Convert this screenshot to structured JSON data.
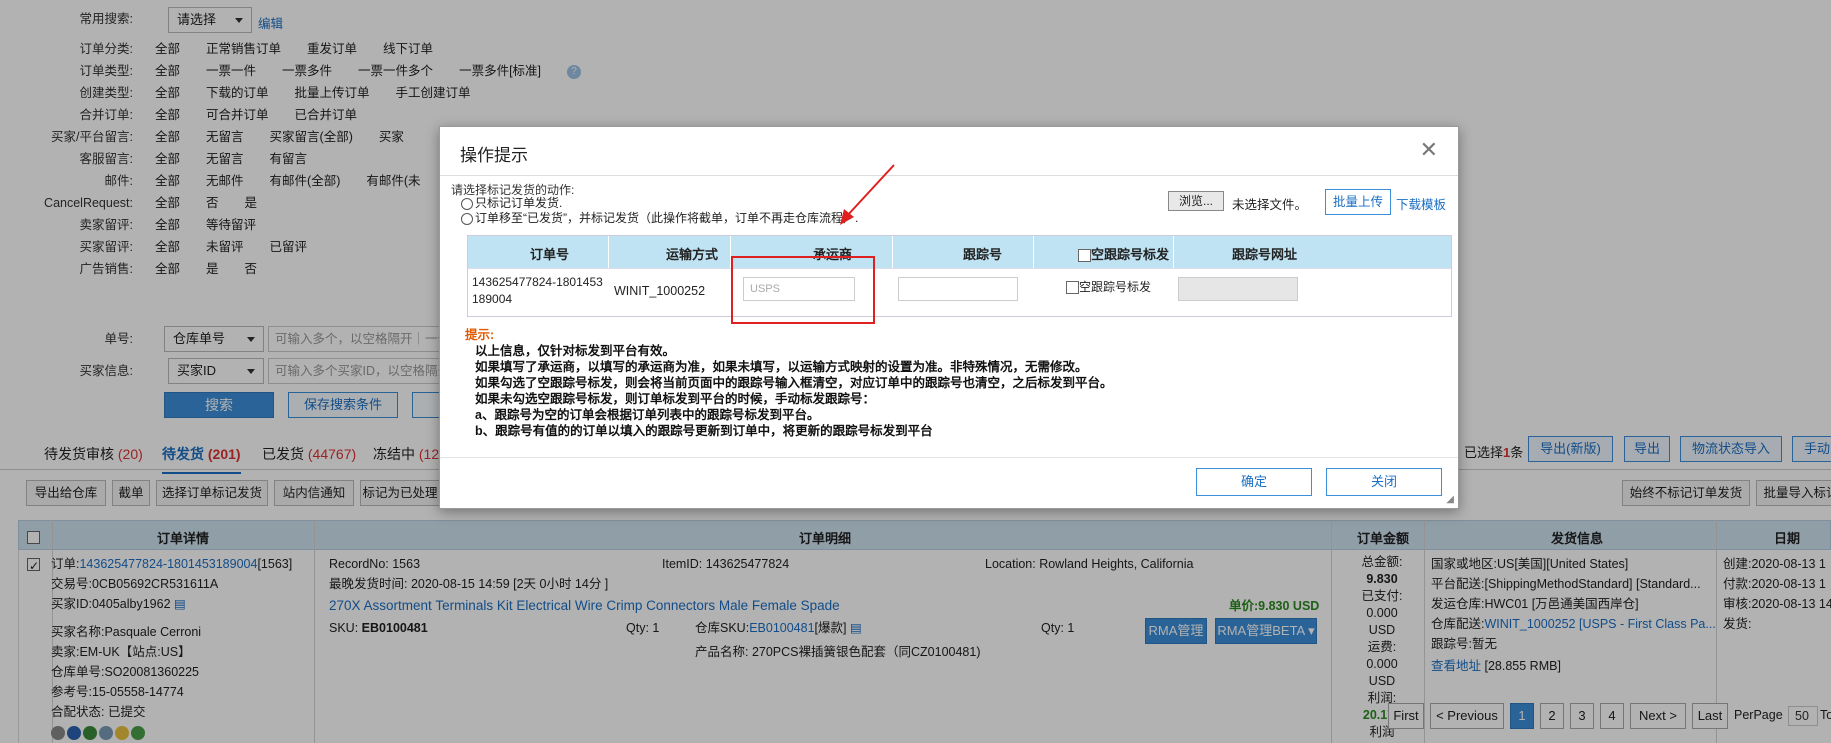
{
  "filters": {
    "common_search": {
      "label": "常用搜索:",
      "select": "请选择",
      "edit": "编辑"
    },
    "rows": [
      {
        "label": "订单分类:",
        "options": [
          "全部",
          "正常销售订单",
          "重发订单",
          "线下订单"
        ]
      },
      {
        "label": "订单类型:",
        "options": [
          "全部",
          "一票一件",
          "一票多件",
          "一票一件多个",
          "一票多件[标准]"
        ]
      },
      {
        "label": "创建类型:",
        "options": [
          "全部",
          "下载的订单",
          "批量上传订单",
          "手工创建订单"
        ]
      },
      {
        "label": "合并订单:",
        "options": [
          "全部",
          "可合并订单",
          "已合并订单"
        ]
      },
      {
        "label": "买家/平台留言:",
        "options": [
          "全部",
          "无留言",
          "买家留言(全部)",
          "买家"
        ]
      },
      {
        "label": "客服留言:",
        "options": [
          "全部",
          "无留言",
          "有留言"
        ]
      },
      {
        "label": "邮件:",
        "options": [
          "全部",
          "无邮件",
          "有邮件(全部)",
          "有邮件(未"
        ]
      },
      {
        "label": "CancelRequest:",
        "options": [
          "全部",
          "否",
          "是"
        ]
      },
      {
        "label": "卖家留评:",
        "options": [
          "全部",
          "等待留评"
        ]
      },
      {
        "label": "买家留评:",
        "options": [
          "全部",
          "未留评",
          "已留评"
        ]
      },
      {
        "label": "广告销售:",
        "options": [
          "全部",
          "是",
          "否"
        ]
      }
    ],
    "order_no": {
      "label": "单号:",
      "select": "仓库单号",
      "placeholder": "可输入多个，以空格隔开｜一个"
    },
    "buyer_info": {
      "label": "买家信息:",
      "select": "买家ID",
      "placeholder": "可输入多个买家ID，以空格隔开"
    },
    "search_button": "搜索",
    "save_search_button": "保存搜索条件"
  },
  "tabs": [
    {
      "label": "待发货审核",
      "count": "(20)"
    },
    {
      "label": "待发货",
      "count": "(201)"
    },
    {
      "label": "已发货",
      "count": "(44767)"
    },
    {
      "label": "冻结中",
      "count": "(12"
    }
  ],
  "right_actions": {
    "selected_prefix": "已选择",
    "selected_count": "1",
    "selected_suffix": "条",
    "export_new": "导出(新版)",
    "export": "导出",
    "logistics_import": "物流状态导入",
    "manual": "手动"
  },
  "toolbar": [
    "导出给仓库",
    "截单",
    "选择订单标记发货",
    "站内信通知",
    "标记为已处理"
  ],
  "toolbar_right": [
    "始终不标记订单发货",
    "批量导入标记"
  ],
  "table_header": {
    "details": "订单详情",
    "detail": "订单明细",
    "amount": "订单金额",
    "shipping": "发货信息",
    "date": "日期"
  },
  "order": {
    "order_no_prefix": "订单:",
    "order_no": "143625477824-1801453189004",
    "order_no_suffix": "[1563]",
    "transaction": "交易号:0CB05692CR531611A",
    "buyer_id": "买家ID:0405alby1962",
    "buyer_name": "买家名称:Pasquale Cerroni",
    "seller": "卖家:EM-UK【站点:US】",
    "warehouse_no": "仓库单号:SO20081360225",
    "ref_no": "参考号:15-05558-14774",
    "status": "合配状态:  已提交",
    "record_no": "RecordNo: 1563",
    "item_id": "ItemID: 143625477824",
    "location": "Location: Rowland Heights, California",
    "latest_ship": "最晚发货时间: 2020-08-15 14:59 [2天 0小时 14分 ]",
    "product_title": "270X Assortment Terminals Kit Electrical Wire Crimp Connectors Male Female Spade",
    "unit_price": "单价:9.830 USD",
    "sku_label": "SKU:",
    "sku": "EB0100481",
    "qty1": "Qty: 1",
    "wh_sku_label": "仓库SKU:",
    "wh_sku": "EB0100481",
    "wh_sku_suffix": "[爆款]",
    "qty2": "Qty: 1",
    "product_name": "产品名称: 270PCS裸插簧银色配套（同CZ0100481)",
    "rma": "RMA管理",
    "rma_beta": "RMA管理BETA ▾",
    "amount_lines": [
      "总金额:",
      "9.830",
      "已支付:",
      "0.000",
      "USD",
      "运费:",
      "0.000",
      "USD",
      "利润:"
    ],
    "profit": "20.171",
    "profit_label": "利润",
    "country": "国家或地区:US[美国][United States]",
    "platform_ship": "平台配送:[ShippingMethodStandard] [Standard...",
    "ship_warehouse": "发运仓库:HWC01 [万邑通美国西岸仓]",
    "wh_ship_label": "仓库配送:",
    "wh_ship": "WINIT_1000252 [USPS - First Class Pa...",
    "tracking": "跟踪号:暂无",
    "view_address": "查看地址",
    "fee": " [28.855 RMB]",
    "created": "创建:2020-08-13 1",
    "paid": "付款:2020-08-13 1",
    "audit": "审核:2020-08-13 14",
    "shipped": "发货:"
  },
  "pager": {
    "first": "First",
    "prev": "< Previous",
    "pages": [
      "1",
      "2",
      "3",
      "4"
    ],
    "next": "Next >",
    "last": "Last",
    "per_page": "PerPage",
    "per_page_value": "50",
    "total": "To"
  },
  "modal": {
    "title": "操作提示",
    "prompt": "请选择标记发货的动作:",
    "option1": "只标记订单发货.",
    "option2": "订单移至“已发货”，并标记发货（此操作将截单，订单不再走仓库流程）.",
    "browse": "浏览...",
    "no_file": "未选择文件。",
    "batch_upload": "批量上传",
    "download_template": "下载模板",
    "table": {
      "headers": [
        "订单号",
        "运输方式",
        "承运商",
        "跟踪号",
        "空跟踪号标发",
        "跟踪号网址"
      ],
      "order_no": "143625477824-1801453189004",
      "shipping_method": "WINIT_1000252",
      "carrier_placeholder": "USPS",
      "empty_tracking": "空跟踪号标发"
    },
    "tips_title": "提示:",
    "tips": [
      "以上信息，仅针对标发到平台有效。",
      "如果填写了承运商，以填写的承运商为准，如果未填写，以运输方式映射的设置为准。非特殊情况，无需修改。",
      "如果勾选了空跟踪号标发，则会将当前页面中的跟踪号输入框清空，对应订单中的跟踪号也清空，之后标发到平台。",
      "如果未勾选空跟踪号标发，则订单标发到平台的时候，手动标发跟踪号：",
      "a、跟踪号为空的订单会根据订单列表中的跟踪号标发到平台。",
      "b、跟踪号有值的的订单以填入的跟踪号更新到订单中，将更新的跟踪号标发到平台"
    ],
    "confirm": "确定",
    "close": "关闭"
  },
  "colors": {
    "accent": "#3b8ed8",
    "header_bg": "#cfe2f1",
    "highlight": "#e02020"
  }
}
